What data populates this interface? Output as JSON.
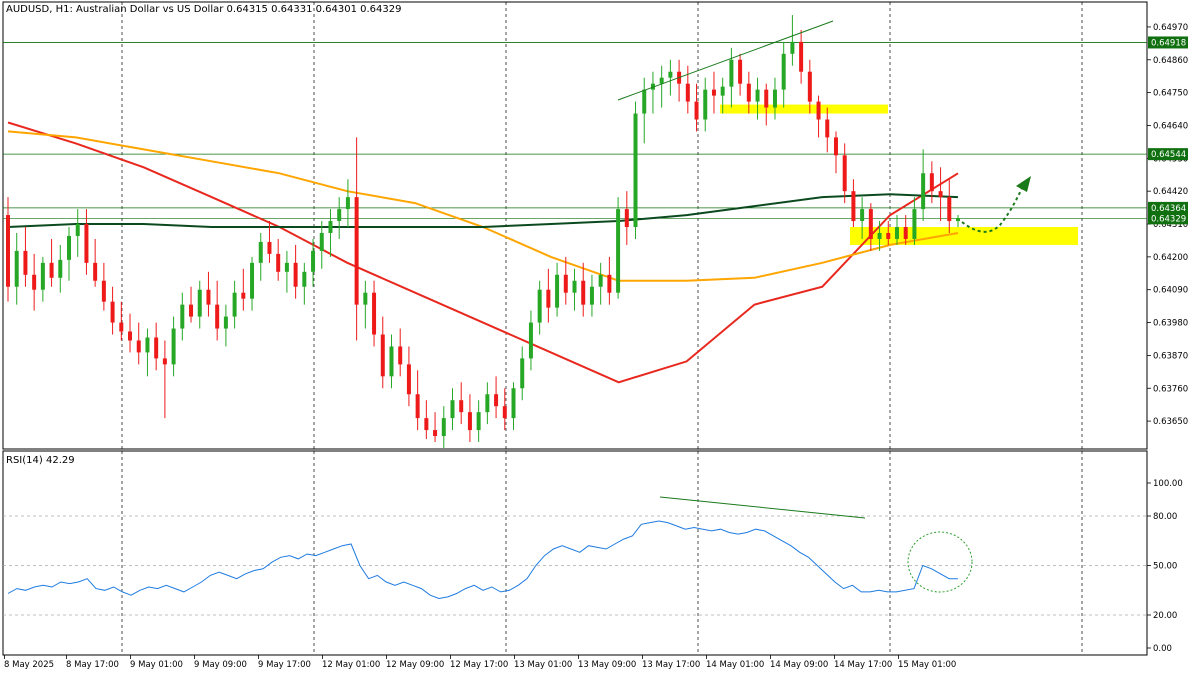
{
  "header": {
    "symbol": "AUDUSD",
    "timeframe": "H1",
    "description": "Australian Dollar vs US Dollar",
    "ohlc": "0.64315 0.64331 0.64301 0.64329"
  },
  "rsi_header": {
    "label": "RSI(14)",
    "value": "42.29"
  },
  "colors": {
    "bull": "#26a826",
    "bear": "#ee1a1a",
    "ma_fast": "#e8281e",
    "ma_mid": "#ffa500",
    "ma_slow": "#0b4a1e",
    "level_lines": "#107010",
    "zone": "#ffff00",
    "rsi_line": "#1e7be0",
    "annotation": "#1a7a1a"
  },
  "chart_data": [
    {
      "type": "candlestick",
      "title": "AUDUSD, H1: Australian Dollar vs US Dollar",
      "ylim": [
        0.6357,
        0.6502
      ],
      "yticks": [
        "0.64970",
        "0.64860",
        "0.64750",
        "0.64640",
        "0.64530",
        "0.64420",
        "0.64310",
        "0.64200",
        "0.64090",
        "0.63980",
        "0.63870",
        "0.63760",
        "0.63650"
      ],
      "price_labels": [
        {
          "value": "0.64918",
          "level": 0.64918
        },
        {
          "value": "0.64544",
          "level": 0.64544
        },
        {
          "value": "0.64364",
          "level": 0.64364
        },
        {
          "value": "0.64329",
          "level": 0.64329
        }
      ],
      "horizontal_levels": [
        0.64918,
        0.64544,
        0.64364
      ],
      "x_labels": [
        "8 May 2025",
        "8 May 17:00",
        "9 May 01:00",
        "9 May 09:00",
        "9 May 17:00",
        "12 May 01:00",
        "12 May 09:00",
        "12 May 17:00",
        "13 May 01:00",
        "13 May 09:00",
        "13 May 17:00",
        "14 May 01:00",
        "14 May 09:00",
        "14 May 17:00",
        "15 May 01:00"
      ],
      "candles": [
        {
          "o": 0.6434,
          "h": 0.644,
          "l": 0.6405,
          "c": 0.641
        },
        {
          "o": 0.641,
          "h": 0.6428,
          "l": 0.6404,
          "c": 0.6422
        },
        {
          "o": 0.6422,
          "h": 0.643,
          "l": 0.641,
          "c": 0.6414
        },
        {
          "o": 0.6414,
          "h": 0.6421,
          "l": 0.6402,
          "c": 0.6409
        },
        {
          "o": 0.6409,
          "h": 0.642,
          "l": 0.6405,
          "c": 0.6418
        },
        {
          "o": 0.6418,
          "h": 0.6426,
          "l": 0.641,
          "c": 0.6413
        },
        {
          "o": 0.6413,
          "h": 0.6424,
          "l": 0.6408,
          "c": 0.6419
        },
        {
          "o": 0.6419,
          "h": 0.643,
          "l": 0.6412,
          "c": 0.6427
        },
        {
          "o": 0.6427,
          "h": 0.6436,
          "l": 0.642,
          "c": 0.6431
        },
        {
          "o": 0.6431,
          "h": 0.6436,
          "l": 0.6414,
          "c": 0.6418
        },
        {
          "o": 0.6418,
          "h": 0.6426,
          "l": 0.641,
          "c": 0.6412
        },
        {
          "o": 0.6412,
          "h": 0.6418,
          "l": 0.6402,
          "c": 0.6405
        },
        {
          "o": 0.6405,
          "h": 0.641,
          "l": 0.6394,
          "c": 0.6398
        },
        {
          "o": 0.6398,
          "h": 0.6405,
          "l": 0.6392,
          "c": 0.6395
        },
        {
          "o": 0.6395,
          "h": 0.6401,
          "l": 0.6388,
          "c": 0.6392
        },
        {
          "o": 0.6392,
          "h": 0.6398,
          "l": 0.6384,
          "c": 0.6388
        },
        {
          "o": 0.6388,
          "h": 0.6396,
          "l": 0.638,
          "c": 0.6393
        },
        {
          "o": 0.6393,
          "h": 0.6398,
          "l": 0.6382,
          "c": 0.6386
        },
        {
          "o": 0.6386,
          "h": 0.6392,
          "l": 0.6366,
          "c": 0.6384
        },
        {
          "o": 0.6384,
          "h": 0.64,
          "l": 0.638,
          "c": 0.6396
        },
        {
          "o": 0.6396,
          "h": 0.6408,
          "l": 0.6392,
          "c": 0.6404
        },
        {
          "o": 0.6404,
          "h": 0.641,
          "l": 0.6398,
          "c": 0.64
        },
        {
          "o": 0.64,
          "h": 0.6412,
          "l": 0.6396,
          "c": 0.6409
        },
        {
          "o": 0.6409,
          "h": 0.6415,
          "l": 0.64,
          "c": 0.6404
        },
        {
          "o": 0.6404,
          "h": 0.6412,
          "l": 0.6392,
          "c": 0.6396
        },
        {
          "o": 0.6396,
          "h": 0.6404,
          "l": 0.639,
          "c": 0.64
        },
        {
          "o": 0.64,
          "h": 0.6412,
          "l": 0.6396,
          "c": 0.6408
        },
        {
          "o": 0.6408,
          "h": 0.6416,
          "l": 0.6402,
          "c": 0.6406
        },
        {
          "o": 0.6406,
          "h": 0.642,
          "l": 0.6402,
          "c": 0.6418
        },
        {
          "o": 0.6418,
          "h": 0.6428,
          "l": 0.6412,
          "c": 0.6425
        },
        {
          "o": 0.6425,
          "h": 0.6432,
          "l": 0.6418,
          "c": 0.6421
        },
        {
          "o": 0.6421,
          "h": 0.6426,
          "l": 0.6412,
          "c": 0.6415
        },
        {
          "o": 0.6415,
          "h": 0.6422,
          "l": 0.6408,
          "c": 0.6418
        },
        {
          "o": 0.6418,
          "h": 0.6424,
          "l": 0.6406,
          "c": 0.641
        },
        {
          "o": 0.641,
          "h": 0.6418,
          "l": 0.6404,
          "c": 0.6415
        },
        {
          "o": 0.6415,
          "h": 0.6426,
          "l": 0.641,
          "c": 0.6422
        },
        {
          "o": 0.6422,
          "h": 0.6432,
          "l": 0.6416,
          "c": 0.6428
        },
        {
          "o": 0.6428,
          "h": 0.6436,
          "l": 0.642,
          "c": 0.6432
        },
        {
          "o": 0.6432,
          "h": 0.644,
          "l": 0.6426,
          "c": 0.6436
        },
        {
          "o": 0.6436,
          "h": 0.6446,
          "l": 0.643,
          "c": 0.644
        },
        {
          "o": 0.644,
          "h": 0.646,
          "l": 0.6392,
          "c": 0.6404
        },
        {
          "o": 0.6404,
          "h": 0.6412,
          "l": 0.6396,
          "c": 0.6408
        },
        {
          "o": 0.6408,
          "h": 0.6412,
          "l": 0.639,
          "c": 0.6394
        },
        {
          "o": 0.6394,
          "h": 0.64,
          "l": 0.6376,
          "c": 0.638
        },
        {
          "o": 0.638,
          "h": 0.6394,
          "l": 0.6376,
          "c": 0.639
        },
        {
          "o": 0.639,
          "h": 0.6396,
          "l": 0.638,
          "c": 0.6384
        },
        {
          "o": 0.6384,
          "h": 0.639,
          "l": 0.637,
          "c": 0.6374
        },
        {
          "o": 0.6374,
          "h": 0.6382,
          "l": 0.6362,
          "c": 0.6366
        },
        {
          "o": 0.6366,
          "h": 0.6372,
          "l": 0.6359,
          "c": 0.6362
        },
        {
          "o": 0.6362,
          "h": 0.6368,
          "l": 0.6358,
          "c": 0.636
        },
        {
          "o": 0.636,
          "h": 0.637,
          "l": 0.6356,
          "c": 0.6366
        },
        {
          "o": 0.6366,
          "h": 0.6376,
          "l": 0.6362,
          "c": 0.6372
        },
        {
          "o": 0.6372,
          "h": 0.6378,
          "l": 0.6364,
          "c": 0.6368
        },
        {
          "o": 0.6368,
          "h": 0.6374,
          "l": 0.6358,
          "c": 0.6362
        },
        {
          "o": 0.6362,
          "h": 0.6372,
          "l": 0.6358,
          "c": 0.6368
        },
        {
          "o": 0.6368,
          "h": 0.6378,
          "l": 0.6364,
          "c": 0.6374
        },
        {
          "o": 0.6374,
          "h": 0.638,
          "l": 0.6366,
          "c": 0.637
        },
        {
          "o": 0.637,
          "h": 0.6376,
          "l": 0.6362,
          "c": 0.6366
        },
        {
          "o": 0.6366,
          "h": 0.6378,
          "l": 0.6362,
          "c": 0.6376
        },
        {
          "o": 0.6376,
          "h": 0.639,
          "l": 0.6372,
          "c": 0.6386
        },
        {
          "o": 0.6386,
          "h": 0.6402,
          "l": 0.6382,
          "c": 0.6398
        },
        {
          "o": 0.6398,
          "h": 0.6412,
          "l": 0.6394,
          "c": 0.6409
        },
        {
          "o": 0.6409,
          "h": 0.6416,
          "l": 0.6398,
          "c": 0.6403
        },
        {
          "o": 0.6403,
          "h": 0.6418,
          "l": 0.64,
          "c": 0.6414
        },
        {
          "o": 0.6414,
          "h": 0.642,
          "l": 0.6404,
          "c": 0.6408
        },
        {
          "o": 0.6408,
          "h": 0.6416,
          "l": 0.6402,
          "c": 0.6412
        },
        {
          "o": 0.6412,
          "h": 0.6418,
          "l": 0.64,
          "c": 0.6404
        },
        {
          "o": 0.6404,
          "h": 0.6414,
          "l": 0.64,
          "c": 0.641
        },
        {
          "o": 0.641,
          "h": 0.6418,
          "l": 0.6404,
          "c": 0.6414
        },
        {
          "o": 0.6414,
          "h": 0.642,
          "l": 0.6404,
          "c": 0.6408
        },
        {
          "o": 0.6408,
          "h": 0.644,
          "l": 0.6406,
          "c": 0.6436
        },
        {
          "o": 0.6436,
          "h": 0.6442,
          "l": 0.6424,
          "c": 0.643
        },
        {
          "o": 0.643,
          "h": 0.6472,
          "l": 0.6426,
          "c": 0.6468
        },
        {
          "o": 0.6468,
          "h": 0.648,
          "l": 0.6458,
          "c": 0.6476
        },
        {
          "o": 0.6476,
          "h": 0.6482,
          "l": 0.6468,
          "c": 0.6478
        },
        {
          "o": 0.6478,
          "h": 0.6484,
          "l": 0.647,
          "c": 0.648
        },
        {
          "o": 0.648,
          "h": 0.6486,
          "l": 0.6474,
          "c": 0.6482
        },
        {
          "o": 0.6482,
          "h": 0.6486,
          "l": 0.6472,
          "c": 0.6478
        },
        {
          "o": 0.6478,
          "h": 0.6484,
          "l": 0.6468,
          "c": 0.6472
        },
        {
          "o": 0.6472,
          "h": 0.6478,
          "l": 0.6462,
          "c": 0.6466
        },
        {
          "o": 0.6466,
          "h": 0.648,
          "l": 0.6462,
          "c": 0.6476
        },
        {
          "o": 0.6476,
          "h": 0.6482,
          "l": 0.6468,
          "c": 0.6474
        },
        {
          "o": 0.6474,
          "h": 0.648,
          "l": 0.6468,
          "c": 0.6477
        },
        {
          "o": 0.6477,
          "h": 0.649,
          "l": 0.647,
          "c": 0.6486
        },
        {
          "o": 0.6486,
          "h": 0.6488,
          "l": 0.6474,
          "c": 0.6478
        },
        {
          "o": 0.6478,
          "h": 0.6482,
          "l": 0.6468,
          "c": 0.6472
        },
        {
          "o": 0.6472,
          "h": 0.648,
          "l": 0.6466,
          "c": 0.6476
        },
        {
          "o": 0.6476,
          "h": 0.6478,
          "l": 0.6464,
          "c": 0.647
        },
        {
          "o": 0.647,
          "h": 0.648,
          "l": 0.6466,
          "c": 0.6476
        },
        {
          "o": 0.6476,
          "h": 0.6492,
          "l": 0.647,
          "c": 0.6488
        },
        {
          "o": 0.6488,
          "h": 0.6501,
          "l": 0.6484,
          "c": 0.6492
        },
        {
          "o": 0.6492,
          "h": 0.6496,
          "l": 0.6478,
          "c": 0.6482
        },
        {
          "o": 0.6482,
          "h": 0.6486,
          "l": 0.6468,
          "c": 0.6472
        },
        {
          "o": 0.6472,
          "h": 0.6474,
          "l": 0.646,
          "c": 0.6466
        },
        {
          "o": 0.6466,
          "h": 0.647,
          "l": 0.6455,
          "c": 0.646
        },
        {
          "o": 0.646,
          "h": 0.6462,
          "l": 0.6448,
          "c": 0.6454
        },
        {
          "o": 0.6454,
          "h": 0.6458,
          "l": 0.6438,
          "c": 0.6442
        },
        {
          "o": 0.6442,
          "h": 0.6446,
          "l": 0.643,
          "c": 0.6432
        },
        {
          "o": 0.6432,
          "h": 0.644,
          "l": 0.6426,
          "c": 0.6436
        },
        {
          "o": 0.6436,
          "h": 0.6438,
          "l": 0.6422,
          "c": 0.6426
        },
        {
          "o": 0.6426,
          "h": 0.6432,
          "l": 0.6422,
          "c": 0.6428
        },
        {
          "o": 0.6428,
          "h": 0.6432,
          "l": 0.6424,
          "c": 0.6426
        },
        {
          "o": 0.6426,
          "h": 0.6434,
          "l": 0.6424,
          "c": 0.643
        },
        {
          "o": 0.643,
          "h": 0.6434,
          "l": 0.6424,
          "c": 0.6426
        },
        {
          "o": 0.6426,
          "h": 0.644,
          "l": 0.6424,
          "c": 0.6436
        },
        {
          "o": 0.6436,
          "h": 0.6456,
          "l": 0.6432,
          "c": 0.6448
        },
        {
          "o": 0.6448,
          "h": 0.6452,
          "l": 0.6438,
          "c": 0.6442
        },
        {
          "o": 0.6442,
          "h": 0.645,
          "l": 0.6432,
          "c": 0.644
        },
        {
          "o": 0.644,
          "h": 0.6446,
          "l": 0.6428,
          "c": 0.6432
        },
        {
          "o": 0.6432,
          "h": 0.6434,
          "l": 0.643,
          "c": 0.6433
        }
      ],
      "moving_averages": [
        {
          "name": "fast",
          "color": "ma_fast",
          "values": [
            0.6465,
            0.6458,
            0.645,
            0.644,
            0.643,
            0.6418,
            0.6408,
            0.6398,
            0.6388,
            0.6378,
            0.6385,
            0.6404,
            0.641,
            0.6434,
            0.6448
          ]
        },
        {
          "name": "mid",
          "color": "ma_mid",
          "values": [
            0.6462,
            0.646,
            0.6456,
            0.6452,
            0.6448,
            0.6442,
            0.6438,
            0.643,
            0.642,
            0.6412,
            0.6412,
            0.6413,
            0.6418,
            0.6424,
            0.6428
          ]
        },
        {
          "name": "slow",
          "color": "ma_slow",
          "values": [
            0.643,
            0.6431,
            0.6431,
            0.643,
            0.643,
            0.643,
            0.643,
            0.643,
            0.6431,
            0.6432,
            0.6434,
            0.6437,
            0.644,
            0.6441,
            0.644
          ]
        }
      ],
      "zones": [
        {
          "from": 0.6468,
          "to": 0.6471
        },
        {
          "from": 0.6424,
          "to": 0.643
        }
      ]
    },
    {
      "type": "line",
      "title": "RSI(14) 42.29",
      "ylim": [
        0,
        100
      ],
      "yticks": [
        "100.00",
        "80.00",
        "50.00",
        "20.00",
        "0.00"
      ],
      "levels": [
        80,
        50,
        20
      ],
      "series": [
        {
          "name": "RSI(14)",
          "values": [
            33,
            36,
            35,
            37,
            38,
            37,
            40,
            39,
            40,
            42,
            36,
            35,
            37,
            34,
            32,
            35,
            37,
            36,
            38,
            36,
            34,
            37,
            40,
            44,
            46,
            44,
            42,
            45,
            47,
            48,
            52,
            55,
            56,
            54,
            57,
            56,
            58,
            60,
            62,
            63,
            50,
            42,
            44,
            40,
            38,
            40,
            38,
            36,
            32,
            30,
            31,
            33,
            36,
            38,
            35,
            37,
            34,
            35,
            38,
            42,
            50,
            56,
            60,
            62,
            60,
            58,
            62,
            61,
            60,
            63,
            66,
            68,
            75,
            76,
            77,
            76,
            74,
            72,
            73,
            72,
            71,
            72,
            70,
            69,
            70,
            72,
            71,
            68,
            65,
            62,
            58,
            55,
            50,
            45,
            40,
            36,
            38,
            34,
            34,
            35,
            34,
            34,
            35,
            36,
            50,
            48,
            45,
            42,
            42
          ]
        }
      ]
    }
  ]
}
